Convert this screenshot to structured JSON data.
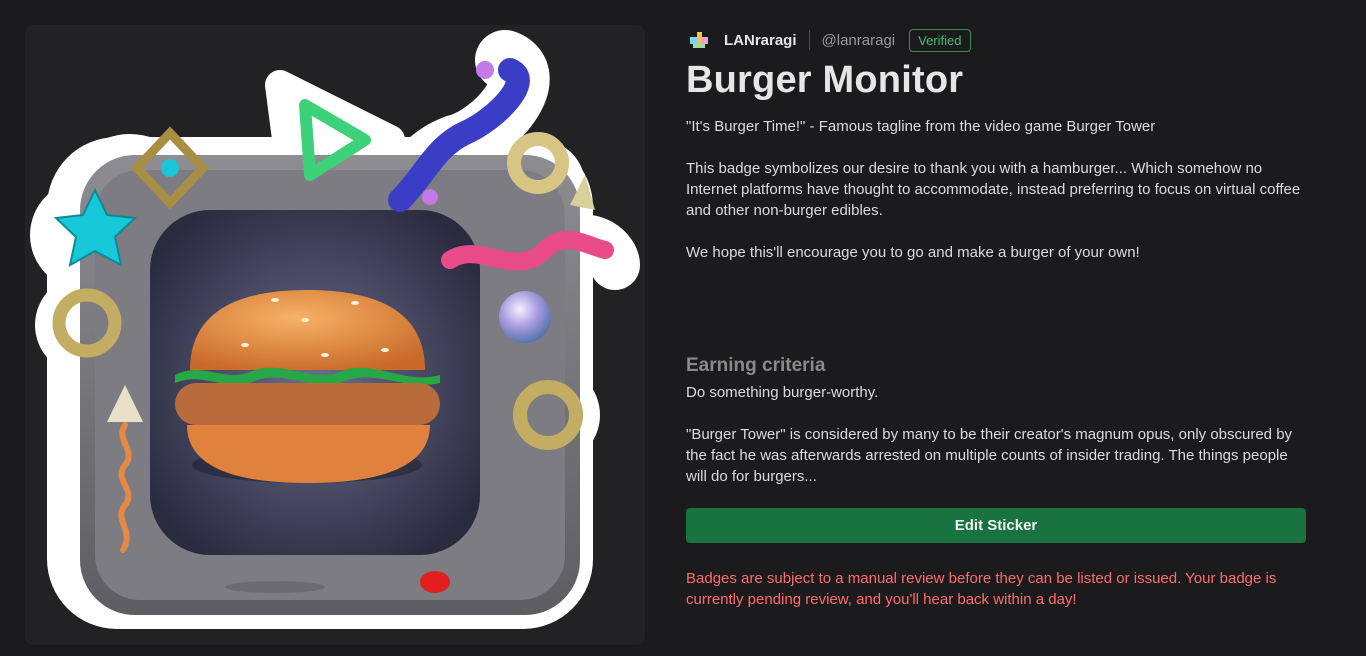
{
  "creator": {
    "name": "LANraragi",
    "handle": "@lanraragi",
    "badge": "Verified",
    "logo_icon": "lanraragi-logo-icon"
  },
  "badge_title": "Burger Monitor",
  "description": [
    "\"It's Burger Time!\" - Famous tagline from the video game Burger Tower",
    "This badge symbolizes our desire to thank you with a hamburger... Which somehow no Internet platforms have thought to accommodate, instead preferring to focus on virtual coffee and other non-burger edibles.",
    "We hope this'll encourage you to go and make a burger of your own!"
  ],
  "earning_criteria": {
    "heading": "Earning criteria",
    "paragraphs": [
      "Do something burger-worthy.",
      "\"Burger Tower\" is considered by many to be their creator's magnum opus, only obscured by the fact he was afterwards arrested on multiple counts of insider trading. The things people will do for burgers..."
    ]
  },
  "edit_button_label": "Edit Sticker",
  "review_notice": "Badges are subject to a manual review before they can be listed or issued. Your badge is currently pending review, and you'll hear back within a day!",
  "colors": {
    "background": "#1b1b1d",
    "verified": "#3ec170",
    "button": "#187341",
    "warning": "#ff6b6b"
  }
}
